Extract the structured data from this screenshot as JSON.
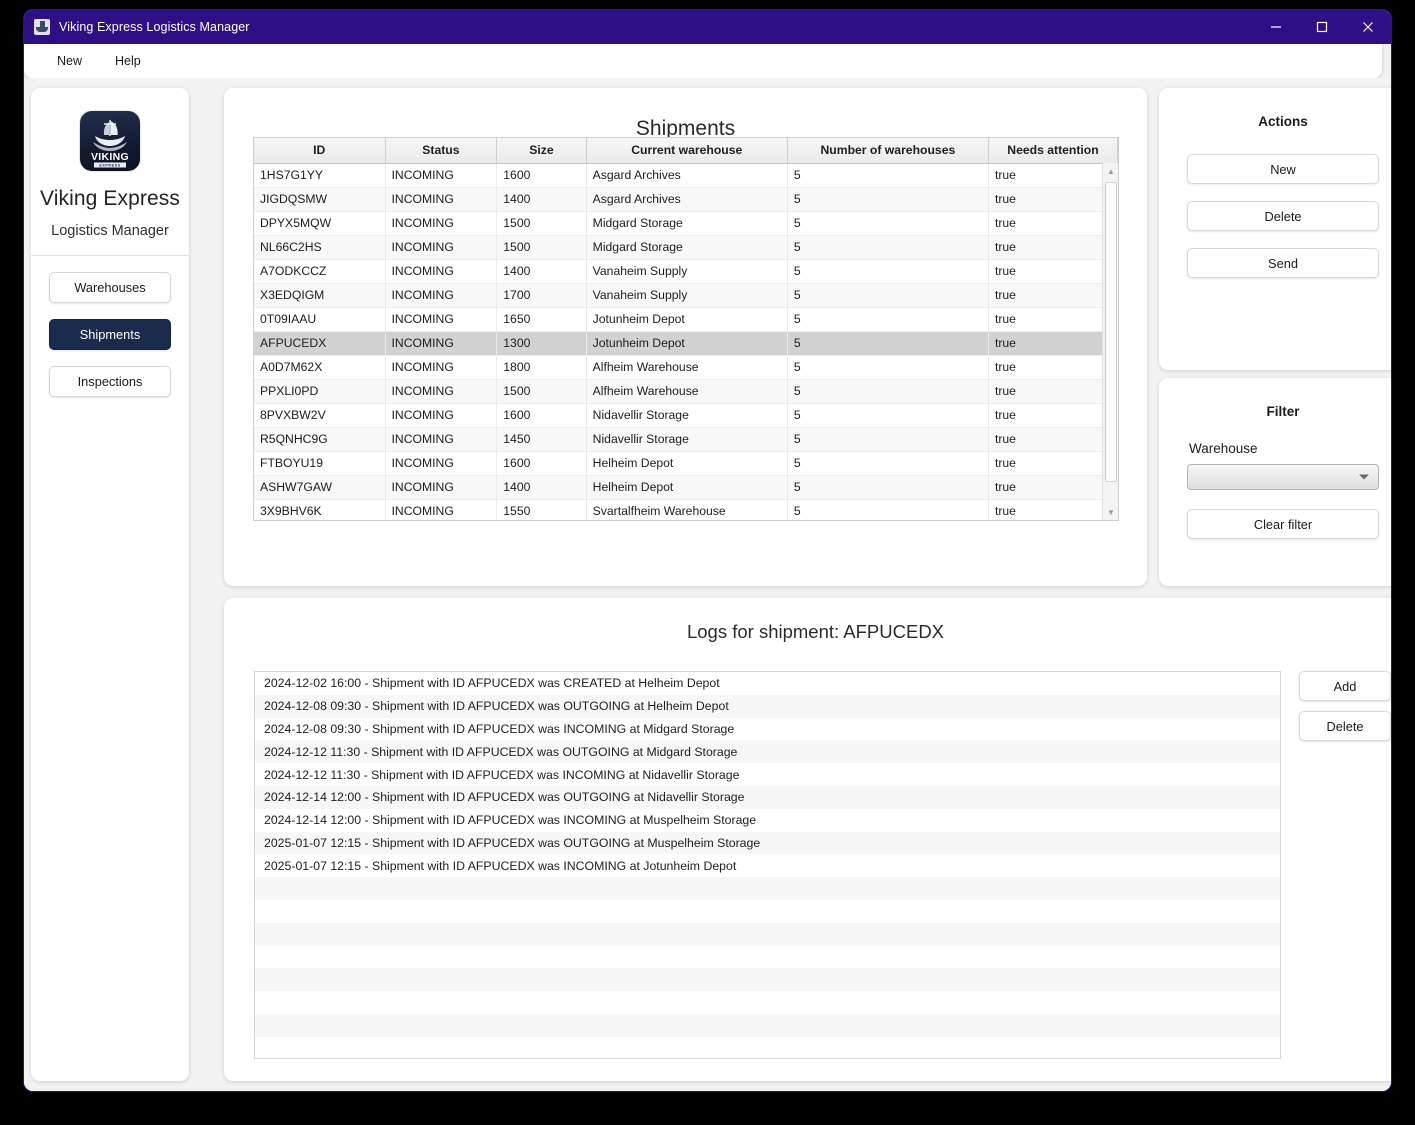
{
  "window": {
    "title": "Viking Express Logistics Manager",
    "app_icon": "app-window-icon",
    "minimize": "–",
    "maximize": "☐",
    "close": "✕"
  },
  "menubar": {
    "items": [
      {
        "label": "New"
      },
      {
        "label": "Help"
      }
    ]
  },
  "sidebar": {
    "logo_alt": "viking-ship-logo",
    "brand": "Viking Express",
    "subbrand": "Logistics Manager",
    "nav": [
      {
        "label": "Warehouses",
        "active": false
      },
      {
        "label": "Shipments",
        "active": true
      },
      {
        "label": "Inspections",
        "active": false
      }
    ]
  },
  "shipments": {
    "title": "Shipments",
    "columns": [
      "ID",
      "Status",
      "Size",
      "Current warehouse",
      "Number of warehouses",
      "Needs attention"
    ],
    "selected_id": "AFPUCEDX",
    "rows": [
      {
        "id": "1HS7G1YY",
        "status": "INCOMING",
        "size": "1600",
        "warehouse": "Asgard Archives",
        "count": "5",
        "attention": "true",
        "selected": false
      },
      {
        "id": "JIGDQSMW",
        "status": "INCOMING",
        "size": "1400",
        "warehouse": "Asgard Archives",
        "count": "5",
        "attention": "true",
        "selected": false
      },
      {
        "id": "DPYX5MQW",
        "status": "INCOMING",
        "size": "1500",
        "warehouse": "Midgard Storage",
        "count": "5",
        "attention": "true",
        "selected": false
      },
      {
        "id": "NL66C2HS",
        "status": "INCOMING",
        "size": "1500",
        "warehouse": "Midgard Storage",
        "count": "5",
        "attention": "true",
        "selected": false
      },
      {
        "id": "A7ODKCCZ",
        "status": "INCOMING",
        "size": "1400",
        "warehouse": "Vanaheim Supply",
        "count": "5",
        "attention": "true",
        "selected": false
      },
      {
        "id": "X3EDQIGM",
        "status": "INCOMING",
        "size": "1700",
        "warehouse": "Vanaheim Supply",
        "count": "5",
        "attention": "true",
        "selected": false
      },
      {
        "id": "0T09IAAU",
        "status": "INCOMING",
        "size": "1650",
        "warehouse": "Jotunheim Depot",
        "count": "5",
        "attention": "true",
        "selected": false
      },
      {
        "id": "AFPUCEDX",
        "status": "INCOMING",
        "size": "1300",
        "warehouse": "Jotunheim Depot",
        "count": "5",
        "attention": "true",
        "selected": true
      },
      {
        "id": "A0D7M62X",
        "status": "INCOMING",
        "size": "1800",
        "warehouse": "Alfheim Warehouse",
        "count": "5",
        "attention": "true",
        "selected": false
      },
      {
        "id": "PPXLI0PD",
        "status": "INCOMING",
        "size": "1500",
        "warehouse": "Alfheim Warehouse",
        "count": "5",
        "attention": "true",
        "selected": false
      },
      {
        "id": "8PVXBW2V",
        "status": "INCOMING",
        "size": "1600",
        "warehouse": "Nidavellir Storage",
        "count": "5",
        "attention": "true",
        "selected": false
      },
      {
        "id": "R5QNHC9G",
        "status": "INCOMING",
        "size": "1450",
        "warehouse": "Nidavellir Storage",
        "count": "5",
        "attention": "true",
        "selected": false
      },
      {
        "id": "FTBOYU19",
        "status": "INCOMING",
        "size": "1600",
        "warehouse": "Helheim Depot",
        "count": "5",
        "attention": "true",
        "selected": false
      },
      {
        "id": "ASHW7GAW",
        "status": "INCOMING",
        "size": "1400",
        "warehouse": "Helheim Depot",
        "count": "5",
        "attention": "true",
        "selected": false
      },
      {
        "id": "3X9BHV6K",
        "status": "INCOMING",
        "size": "1550",
        "warehouse": "Svartalfheim Warehouse",
        "count": "5",
        "attention": "true",
        "selected": false
      }
    ]
  },
  "actions": {
    "title": "Actions",
    "new_label": "New",
    "delete_label": "Delete",
    "send_label": "Send"
  },
  "filter": {
    "title": "Filter",
    "warehouse_label": "Warehouse",
    "warehouse_value": "",
    "clear_label": "Clear filter"
  },
  "logs": {
    "title": "Logs for shipment: AFPUCEDX",
    "add_label": "Add",
    "delete_label": "Delete",
    "entries": [
      "2024-12-02 16:00 - Shipment with ID AFPUCEDX was CREATED at Helheim Depot",
      "2024-12-08 09:30 - Shipment with ID AFPUCEDX was OUTGOING at Helheim Depot",
      "2024-12-08 09:30 - Shipment with ID AFPUCEDX was INCOMING at Midgard Storage",
      "2024-12-12 11:30 - Shipment with ID AFPUCEDX was OUTGOING at Midgard Storage",
      "2024-12-12 11:30 - Shipment with ID AFPUCEDX was INCOMING at Nidavellir Storage",
      "2024-12-14 12:00 - Shipment with ID AFPUCEDX was OUTGOING at Nidavellir Storage",
      "2024-12-14 12:00 - Shipment with ID AFPUCEDX was INCOMING at Muspelheim Storage",
      "2025-01-07 12:15 - Shipment with ID AFPUCEDX was OUTGOING at Muspelheim Storage",
      "2025-01-07 12:15 - Shipment with ID AFPUCEDX was INCOMING at Jotunheim Depot"
    ],
    "empty_row_count": 8
  },
  "colors": {
    "titlebar": "#2e0f86",
    "nav_active": "#1b2b4d",
    "row_selected": "#d2d2d2",
    "page_bg": "#f2f2f2"
  }
}
